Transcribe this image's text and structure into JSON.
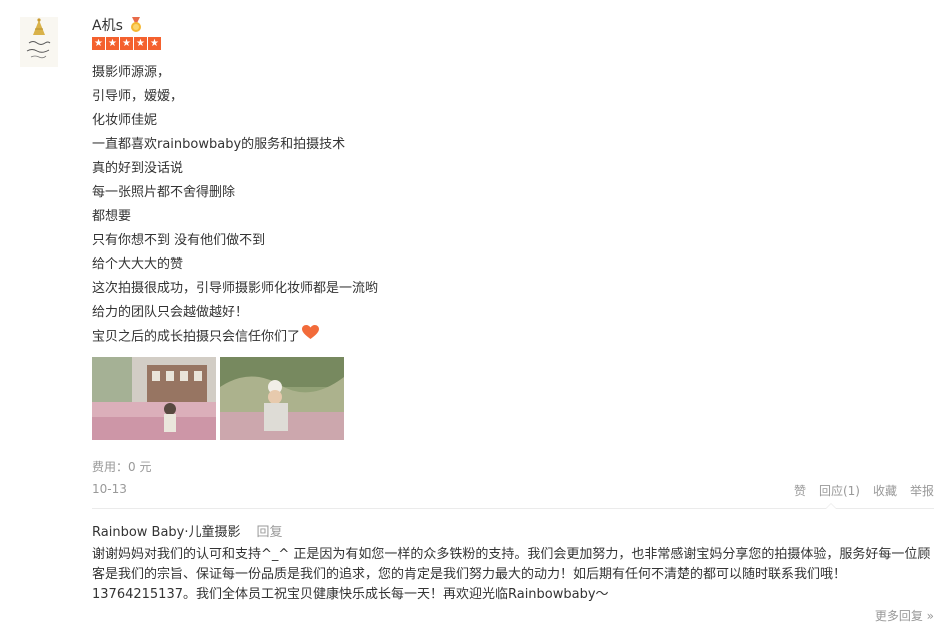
{
  "review": {
    "username": "A机s",
    "rating": 5,
    "lines": [
      "摄影师源源，",
      "引导师，嫒嫒，",
      "化妆师佳妮",
      "一直都喜欢rainbowbaby的服务和拍摄技术",
      "真的好到没话说",
      "每一张照片都不舍得删除",
      "都想要",
      "只有你想不到 没有他们做不到",
      "给个大大大的赞",
      "这次拍摄很成功，引导师摄影师化妆师都是一流哟",
      "给力的团队只会越做越好！",
      "宝贝之后的成长拍摄只会信任你们了"
    ],
    "cost": "费用：0 元",
    "date": "10-13",
    "actions": {
      "like": "赞",
      "reply": "回应(1)",
      "favorite": "收藏",
      "report": "举报"
    }
  },
  "merchant_reply": {
    "author": "Rainbow Baby·儿童摄影",
    "reply_label": "回复",
    "text": "谢谢妈妈对我们的认可和支持^_^ 正是因为有如您一样的众多铁粉的支持。我们会更加努力，也非常感谢宝妈分享您的拍摄体验，服务好每一位顾客是我们的宗旨、保证每一份品质是我们的追求，您的肯定是我们努力最大的动力！如后期有任何不清楚的都可以随时联系我们哦！13764215137。我们全体员工祝宝贝健康快乐成长每一天！再欢迎光临Rainbowbaby～"
  },
  "more_replies": "更多回复 »",
  "colors": {
    "star": "#f4612e",
    "muted": "#999999",
    "text": "#333333",
    "heart": "#f26b3a"
  }
}
